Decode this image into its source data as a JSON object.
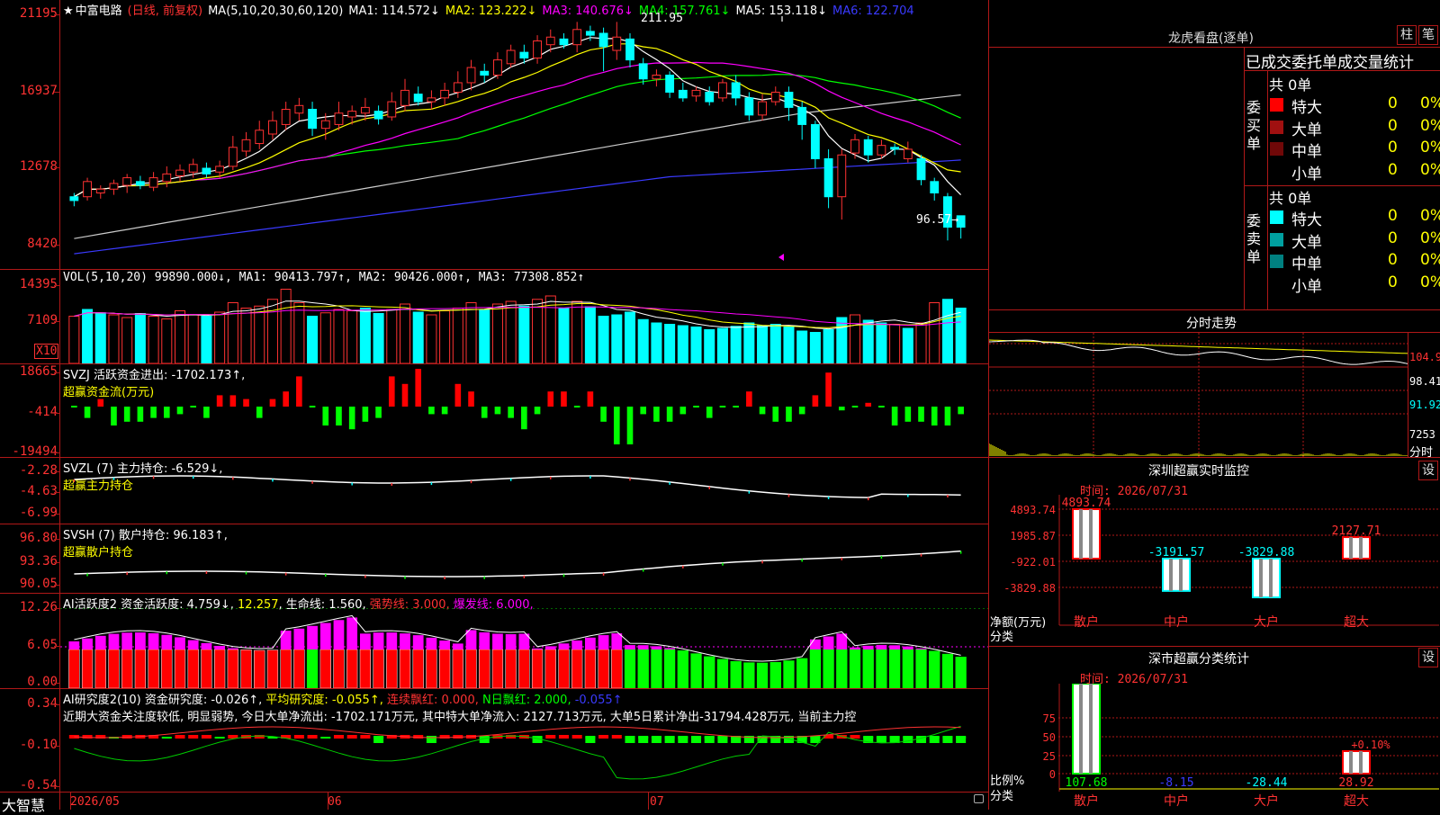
{
  "kline": {
    "title_star": "★",
    "stock_name": "中富电路",
    "mode": "(日线, 前复权)",
    "ma_label": "MA(5,10,20,30,60,120)",
    "ma": [
      {
        "label": "MA1: 114.572↓",
        "color": "#ffffff"
      },
      {
        "label": "MA2: 123.222↓",
        "color": "#ffff00"
      },
      {
        "label": "MA3: 140.676↓",
        "color": "#ff00ff"
      },
      {
        "label": "MA4: 157.761↓",
        "color": "#00ff00"
      },
      {
        "label": "MA5: 153.118↓",
        "color": "#ffffff"
      },
      {
        "label": "MA6: 122.704",
        "color": "#3a3aff"
      }
    ],
    "y_labels": [
      "21195",
      "16937",
      "12678",
      "8420"
    ],
    "high_label": "211.95",
    "low_label": "96.57→",
    "candles": [
      [
        118,
        120,
        115,
        122,
        "c"
      ],
      [
        120,
        128,
        118,
        130,
        "r"
      ],
      [
        122,
        124,
        119,
        126,
        "r"
      ],
      [
        124,
        127,
        121,
        129,
        "r"
      ],
      [
        126,
        130,
        122,
        132,
        "r"
      ],
      [
        128,
        126,
        124,
        131,
        "c"
      ],
      [
        125,
        130,
        123,
        133,
        "r"
      ],
      [
        128,
        132,
        125,
        136,
        "r"
      ],
      [
        131,
        134,
        128,
        137,
        "r"
      ],
      [
        133,
        137,
        130,
        140,
        "r"
      ],
      [
        135,
        132,
        130,
        138,
        "c"
      ],
      [
        133,
        136,
        130,
        139,
        "r"
      ],
      [
        136,
        146,
        134,
        152,
        "r"
      ],
      [
        144,
        150,
        141,
        154,
        "r"
      ],
      [
        148,
        155,
        145,
        160,
        "r"
      ],
      [
        153,
        160,
        150,
        165,
        "r"
      ],
      [
        158,
        166,
        155,
        170,
        "r"
      ],
      [
        164,
        168,
        160,
        172,
        "r"
      ],
      [
        166,
        156,
        152,
        170,
        "c"
      ],
      [
        156,
        160,
        150,
        164,
        "r"
      ],
      [
        158,
        164,
        155,
        170,
        "r"
      ],
      [
        162,
        165,
        158,
        168,
        "r"
      ],
      [
        164,
        167,
        160,
        172,
        "r"
      ],
      [
        165,
        161,
        158,
        168,
        "c"
      ],
      [
        162,
        170,
        160,
        175,
        "r"
      ],
      [
        168,
        176,
        165,
        182,
        "r"
      ],
      [
        174,
        170,
        168,
        178,
        "c"
      ],
      [
        170,
        172,
        166,
        176,
        "r"
      ],
      [
        172,
        176,
        168,
        180,
        "r"
      ],
      [
        175,
        180,
        172,
        186,
        "r"
      ],
      [
        180,
        188,
        176,
        192,
        "r"
      ],
      [
        186,
        184,
        180,
        190,
        "c"
      ],
      [
        184,
        192,
        182,
        196,
        "r"
      ],
      [
        190,
        197,
        188,
        200,
        "r"
      ],
      [
        196,
        193,
        190,
        200,
        "c"
      ],
      [
        193,
        202,
        190,
        205,
        "r"
      ],
      [
        200,
        204,
        196,
        208,
        "r"
      ],
      [
        203,
        200,
        198,
        206,
        "c"
      ],
      [
        200,
        208,
        196,
        212,
        "r"
      ],
      [
        207,
        205,
        202,
        210,
        "c"
      ],
      [
        206,
        199,
        186,
        209,
        "c"
      ],
      [
        197,
        204,
        192,
        212,
        "r"
      ],
      [
        203,
        192,
        188,
        206,
        "c"
      ],
      [
        190,
        182,
        179,
        193,
        "c"
      ],
      [
        182,
        184,
        178,
        187,
        "r"
      ],
      [
        184,
        175,
        172,
        186,
        "c"
      ],
      [
        176,
        172,
        170,
        180,
        "c"
      ],
      [
        173,
        176,
        170,
        178,
        "r"
      ],
      [
        175,
        170,
        168,
        178,
        "c"
      ],
      [
        172,
        180,
        170,
        182,
        "r"
      ],
      [
        180,
        172,
        168,
        184,
        "c"
      ],
      [
        172,
        163,
        160,
        175,
        "c"
      ],
      [
        163,
        170,
        160,
        174,
        "r"
      ],
      [
        170,
        175,
        168,
        178,
        "r"
      ],
      [
        175,
        167,
        160,
        178,
        "c"
      ],
      [
        167,
        158,
        150,
        170,
        "c"
      ],
      [
        158,
        140,
        135,
        160,
        "c"
      ],
      [
        140,
        120,
        114,
        145,
        "c"
      ],
      [
        120,
        142,
        108,
        145,
        "r"
      ],
      [
        143,
        150,
        140,
        153,
        "r"
      ],
      [
        150,
        142,
        138,
        152,
        "c"
      ],
      [
        142,
        147,
        140,
        150,
        "r"
      ],
      [
        146,
        145,
        142,
        148,
        "c"
      ],
      [
        145,
        140,
        138,
        149,
        "r"
      ],
      [
        140,
        129,
        126,
        142,
        "c"
      ],
      [
        128,
        122,
        118,
        130,
        "c"
      ],
      [
        120,
        104,
        97,
        122,
        "c"
      ],
      [
        104,
        110,
        98,
        110,
        "c"
      ]
    ]
  },
  "vol": {
    "header": "VOL(5,10,20) 99890.000↓, MA1: 90413.797↑, MA2: 90426.000↑, MA3: 77308.852↑",
    "y_labels": [
      "14395",
      "7109"
    ],
    "unit": "X10",
    "values": [
      70,
      80,
      75,
      72,
      68,
      74,
      70,
      66,
      78,
      72,
      70,
      76,
      90,
      82,
      85,
      95,
      110,
      90,
      70,
      75,
      80,
      78,
      82,
      74,
      80,
      88,
      76,
      72,
      78,
      82,
      90,
      80,
      88,
      92,
      85,
      95,
      100,
      82,
      92,
      84,
      70,
      72,
      76,
      65,
      60,
      58,
      56,
      54,
      50,
      52,
      55,
      60,
      56,
      58,
      54,
      48,
      46,
      50,
      68,
      72,
      64,
      60,
      58,
      52,
      60,
      90,
      95,
      82
    ],
    "colors": "rccrrcrrrrcrrrrrrrcrrrccrrcrrrrcrrcrrcrc cccccccccccccccccccrccrcrrcccrcrr"
  },
  "svzj": {
    "header": "SVZJ  活跃资金进出: -1702.173↑,",
    "subtitle": "超赢资金流(万元)",
    "y_labels": [
      "18665",
      "-414",
      "-19494"
    ],
    "values": [
      0,
      -3,
      2,
      -5,
      -4,
      -4,
      -3,
      -3,
      -2,
      0,
      -3,
      3,
      3,
      2,
      -3,
      2,
      4,
      8,
      0,
      -5,
      -5,
      -6,
      -4,
      -3,
      8,
      6,
      10,
      -2,
      -2,
      6,
      4,
      -3,
      -2,
      -3,
      -6,
      -2,
      4,
      4,
      0,
      4,
      -4,
      -10,
      -10,
      -2,
      -4,
      -4,
      -2,
      0,
      -3,
      0,
      0,
      4,
      -2,
      -4,
      -4,
      -2,
      3,
      9,
      -1,
      0,
      1,
      0,
      -5,
      -4,
      -4,
      -5,
      -5,
      -2
    ]
  },
  "svzl": {
    "header": "SVZL (7) 主力持仓: -6.529↓,",
    "subtitle": "超赢主力持仓",
    "y_labels": [
      "-2.28",
      "-4.63",
      "-6.99"
    ]
  },
  "svsh": {
    "header": "SVSH (7) 散户持仓: 96.183↑,",
    "subtitle": "超赢散户持仓",
    "y_labels": [
      "96.80",
      "93.36",
      "90.05"
    ]
  },
  "ai_active": {
    "header_parts": [
      {
        "t": "AI活跃度2 资金活跃度: 4.759↓, ",
        "c": "#ffffff"
      },
      {
        "t": "12.257",
        "c": "#ffff00"
      },
      {
        "t": ", 生命线: 1.560, ",
        "c": "#ffffff"
      },
      {
        "t": "强势线: 3.000, ",
        "c": "#ff3232"
      },
      {
        "t": "爆发线: 6.000,",
        "c": "#ff00ff"
      }
    ],
    "y_labels": [
      "12.26",
      "6.05",
      "0.00"
    ]
  },
  "ai_research": {
    "header_parts": [
      {
        "t": "AI研究度2(10) 资金研究度: -0.026↑, ",
        "c": "#ffffff"
      },
      {
        "t": "平均研究度: -0.055↑, ",
        "c": "#ffff00"
      },
      {
        "t": "连续飘红: 0.000, ",
        "c": "#ff3232"
      },
      {
        "t": "N日飘红: 2.000, ",
        "c": "#00ff00"
      },
      {
        "t": "-0.055↑",
        "c": "#3a3aff"
      }
    ],
    "message": "近期大资金关注度较低, 明显弱势, 今日大单净流出: -1702.171万元, 其中特大单净流入: 2127.713万元, 大单5日累计净出-31794.428万元, 当前主力控",
    "y_labels": [
      "0.34",
      "-0.10",
      "-0.54"
    ]
  },
  "x_axis": {
    "labels": [
      "2026/05",
      "06",
      "07"
    ]
  },
  "brand": "大智慧",
  "right": {
    "longhu_title": "龙虎看盘(逐单)",
    "btn_zhu": "柱",
    "btn_bi": "笔",
    "order_stats_title": "已成交委托单成交量统计",
    "buy_label": "委买单",
    "sell_label": "委卖单",
    "buy_total": "共 0单",
    "sell_total": "共 0单",
    "buy_rows": [
      {
        "name": "特大",
        "count": "0",
        "pct": "0%",
        "color": "#ff0000"
      },
      {
        "name": "大单",
        "count": "0",
        "pct": "0%",
        "color": "#a01010"
      },
      {
        "name": "中单",
        "count": "0",
        "pct": "0%",
        "color": "#700808"
      },
      {
        "name": "小单",
        "count": "0",
        "pct": "0%",
        "color": ""
      }
    ],
    "sell_rows": [
      {
        "name": "特大",
        "count": "0",
        "pct": "0%",
        "color": "#00ffff"
      },
      {
        "name": "大单",
        "count": "0",
        "pct": "0%",
        "color": "#00a0a0"
      },
      {
        "name": "中单",
        "count": "0",
        "pct": "0%",
        "color": "#008080"
      },
      {
        "name": "小单",
        "count": "0",
        "pct": "0%",
        "color": ""
      }
    ],
    "intraday_title": "分时走势",
    "intraday_labels": [
      "104.9",
      "98.41",
      "91.92",
      "7253",
      "分时"
    ],
    "sz_monitor_title": "深圳超赢实时监控",
    "sz_monitor_btn": "设",
    "sz_time": "时间: 2026/07/31",
    "sz_y": [
      "4893.74",
      "1985.87",
      "-922.01",
      "-3829.88"
    ],
    "sz_values": [
      {
        "cat": "散户",
        "val": "4893.74"
      },
      {
        "cat": "中户",
        "val": "-3191.57"
      },
      {
        "cat": "大户",
        "val": "-3829.88"
      },
      {
        "cat": "超大",
        "val": "2127.71"
      }
    ],
    "sz_axis_name": "净额(万元)",
    "sz_axis_cat": "分类",
    "market_title": "深市超赢分类统计",
    "market_btn": "设",
    "market_time": "时间: 2026/07/31",
    "market_y": [
      "75",
      "50",
      "25",
      "0"
    ],
    "market_values": [
      {
        "cat": "散户",
        "val": "107.68"
      },
      {
        "cat": "中户",
        "val": "-8.15"
      },
      {
        "cat": "大户",
        "val": "-28.44"
      },
      {
        "cat": "超大",
        "val": "28.92"
      }
    ],
    "market_extra": "+0.10%",
    "market_axis_name": "比例%",
    "market_axis_cat": "分类"
  }
}
